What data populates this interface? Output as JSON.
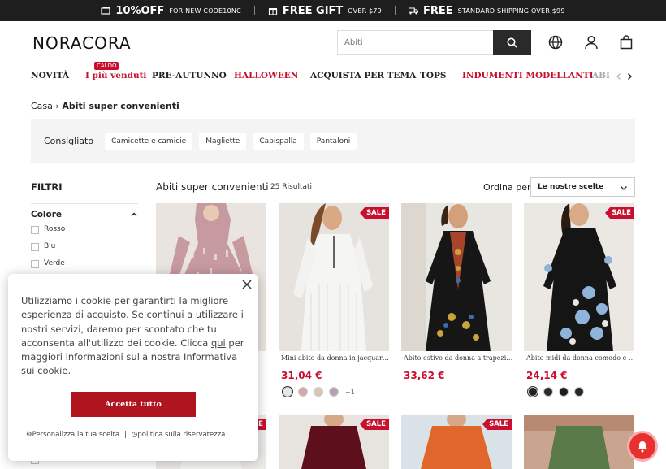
{
  "promo": [
    {
      "big": "10%OFF",
      "small": "FOR NEW   CODE10NC"
    },
    {
      "big": "FREE GIFT",
      "small": "OVER $79"
    },
    {
      "big": "FREE",
      "small": "STANDARD SHIPPING OVER $99"
    }
  ],
  "header": {
    "logo": "NORACORA",
    "search_placeholder": "Abiti"
  },
  "nav": {
    "items": [
      "NOVITÀ",
      "I più venduti",
      "PRE-AUTUNNO",
      "HALLOWEEN",
      "ACQUISTA PER TEMA",
      "TOPS",
      "INDUMENTI MODELLANTI",
      "ABI"
    ],
    "hot_badge": "CALDO"
  },
  "breadcrumb": {
    "home": "Casa",
    "current": "Abiti super convenienti"
  },
  "recommended": {
    "label": "Consigliato",
    "chips": [
      "Camicette e camicie",
      "Magliette",
      "Capispalla",
      "Pantaloni"
    ]
  },
  "filters": {
    "title": "FILTRI",
    "group": "Colore",
    "options": [
      "Rosso",
      "Blu",
      "Verde"
    ]
  },
  "results": {
    "title": "Abiti super convenienti",
    "count": "25 Risultati",
    "sort_label": "Ordina per",
    "sort_value": "Le nostre scelte"
  },
  "products": [
    {
      "name": "",
      "price": "",
      "sale": ""
    },
    {
      "name": "Mini abito da donna in jacquard, ...",
      "price": "31,04 €",
      "sale": "SALE",
      "more": "+1"
    },
    {
      "name": "Abito estivo da donna a trapezio, ...",
      "price": "33,62 €",
      "sale": ""
    },
    {
      "name": "Abito midi da donna comodo e ca...",
      "price": "24,14 €",
      "sale": "SALE"
    }
  ],
  "row2_sales": [
    "SALE",
    "SALE",
    "SALE"
  ],
  "cookie": {
    "text_before": "Utilizziamo i cookie per garantirti la migliore esperienza di acquisto. Se continui a utilizzare i nostri servizi, daremo per scontato che tu acconsenta all'utilizzo dei cookie. Clicca ",
    "link": "qui",
    "text_after": " per maggiori informazioni sulla nostra Informativa sui cookie.",
    "accept": "Accetta tutto",
    "customize": "Personalizza la tua scelta",
    "divider": "|",
    "privacy": "politica sulla riservatezza"
  },
  "colors": {
    "accent": "#c8102e",
    "dark": "#1e1e1e"
  }
}
